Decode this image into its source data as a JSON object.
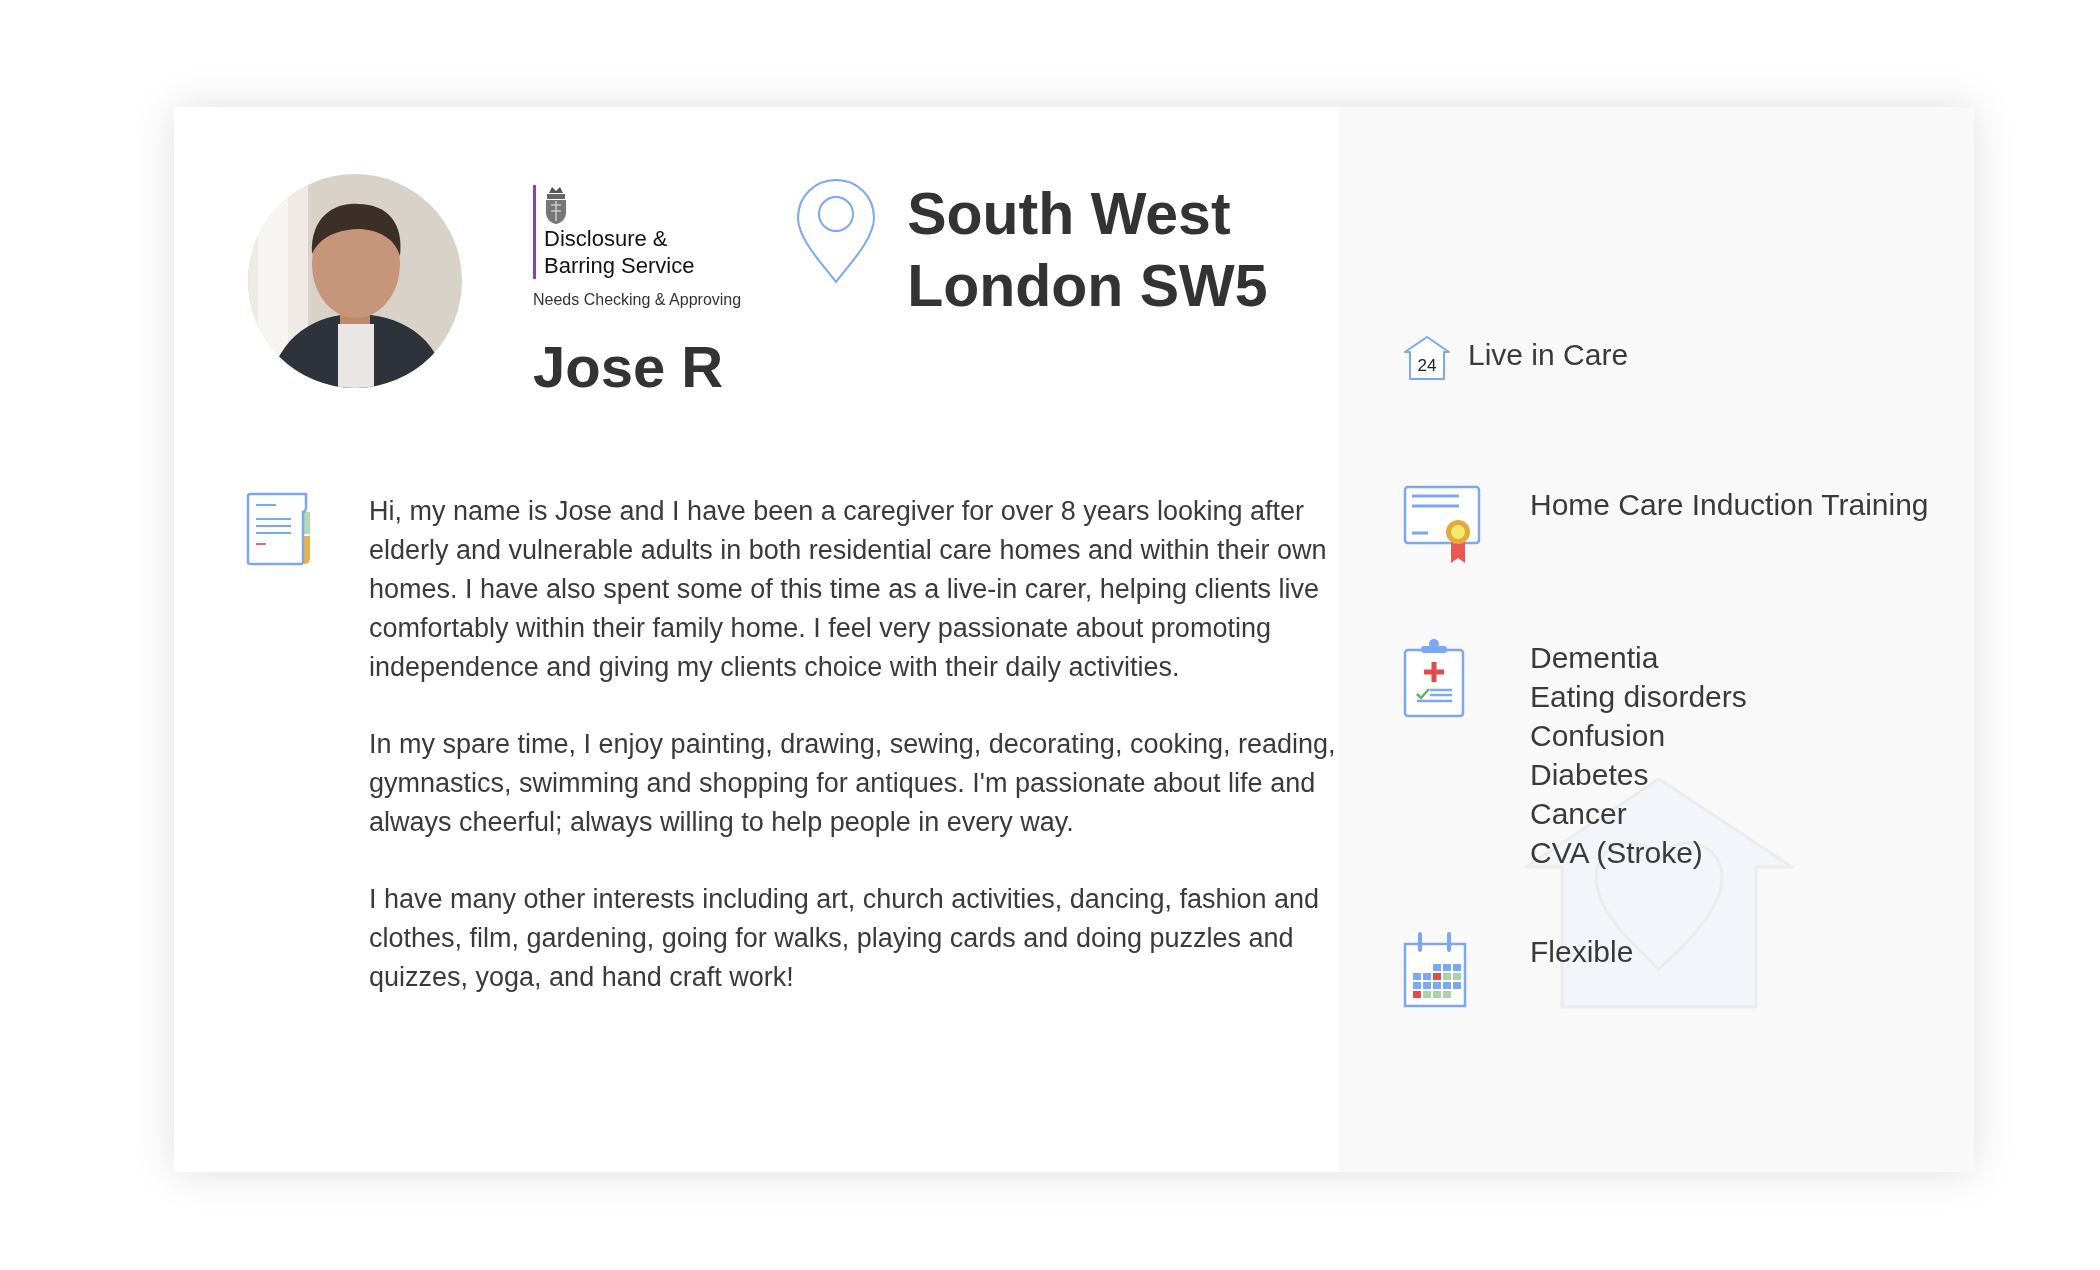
{
  "profile": {
    "dbs": {
      "title": "Disclosure & Barring Service",
      "status": "Needs Checking & Approving"
    },
    "name": "Jose R",
    "location": "South West London SW5"
  },
  "bio": [
    "Hi, my name is Jose and I have been a caregiver for over 8 years looking after elderly and vulnerable adults in both residential care homes and within their own homes. I have also spent some of this time as a live-in carer, helping clients live comfortably within their family home. I feel very passionate about promoting independence and giving my clients choice with their daily activities.",
    "In my spare time, I enjoy painting, drawing, sewing, decorating, cooking, reading, gymnastics, swimming and shopping for antiques. I'm passionate about life and always cheerful; always willing to help people in every way.",
    "I have many other interests including art, church activities, dancing, fashion and clothes, film, gardening, going for walks, playing cards and doing puzzles and quizzes, yoga, and hand craft work!"
  ],
  "features": [
    {
      "kind": "live_in",
      "icon_label": "24",
      "lines": [
        "Live in Care"
      ]
    },
    {
      "kind": "training",
      "lines": [
        "Home Care Induction Training"
      ]
    },
    {
      "kind": "conditions",
      "lines": [
        "Dementia",
        "Eating disorders",
        "Confusion",
        "Diabetes",
        "Cancer",
        "CVA (Stroke)"
      ]
    },
    {
      "kind": "availability",
      "lines": [
        "Flexible"
      ]
    }
  ]
}
